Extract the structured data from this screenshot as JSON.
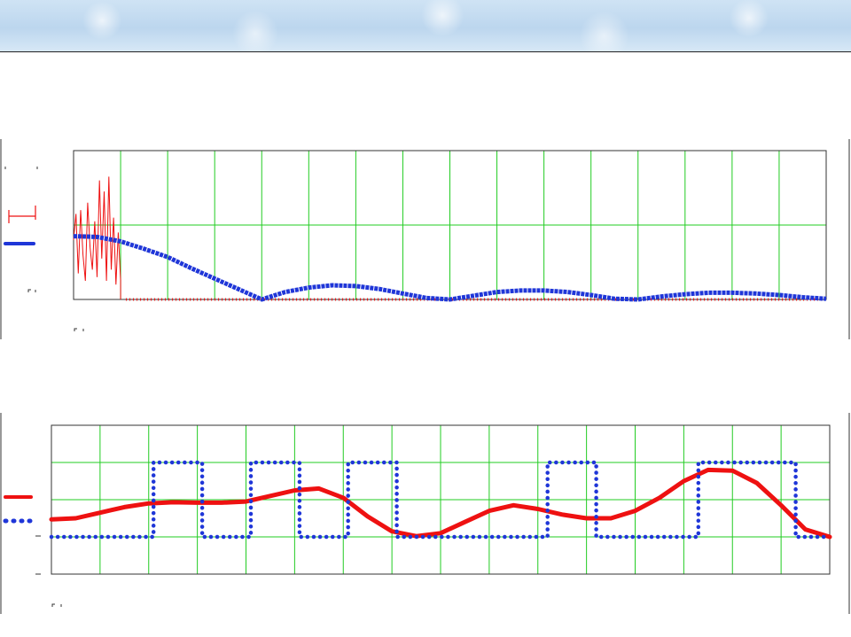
{
  "colors": {
    "background": "#ffffff",
    "header_band": "#c6ddf1",
    "grid": "#22cc22",
    "frame": "#333333",
    "blue_series": "#1f36d8",
    "red_series": "#ee1111"
  },
  "chart_data": [
    {
      "type": "line",
      "title": "",
      "xlabel": "",
      "ylabel": "",
      "xlim": [
        0,
        16
      ],
      "ylim": [
        0,
        2
      ],
      "grid": true,
      "legend": "left",
      "series": [
        {
          "role": "noisy-red",
          "color": "#ee1111",
          "style": "thin-line-then-ticks",
          "x": [
            0.0,
            0.05,
            0.1,
            0.15,
            0.2,
            0.25,
            0.3,
            0.35,
            0.4,
            0.45,
            0.5,
            0.55,
            0.6,
            0.65,
            0.7,
            0.75,
            0.8,
            0.85,
            0.9,
            0.95,
            1.0
          ],
          "y": [
            0.8,
            1.15,
            0.35,
            1.2,
            0.6,
            0.25,
            1.3,
            0.7,
            0.4,
            1.05,
            0.3,
            1.6,
            0.55,
            1.45,
            0.25,
            1.65,
            0.4,
            1.1,
            0.2,
            0.9,
            0.25
          ]
        },
        {
          "role": "blue-envelope",
          "color": "#1f36d8",
          "style": "thick-dotted",
          "x": [
            0,
            0.5,
            1,
            1.5,
            2,
            2.5,
            3,
            3.5,
            4,
            4.5,
            5,
            5.5,
            6,
            6.5,
            7,
            7.5,
            8,
            8.5,
            9,
            9.5,
            10,
            10.5,
            11,
            11.5,
            12,
            12.5,
            13,
            13.5,
            14,
            14.5,
            15,
            15.5,
            16
          ],
          "y": [
            0.85,
            0.84,
            0.78,
            0.68,
            0.57,
            0.42,
            0.28,
            0.14,
            0.0,
            0.1,
            0.16,
            0.19,
            0.18,
            0.14,
            0.08,
            0.02,
            0.0,
            0.05,
            0.1,
            0.12,
            0.12,
            0.1,
            0.06,
            0.01,
            0.0,
            0.04,
            0.07,
            0.09,
            0.09,
            0.08,
            0.06,
            0.03,
            0.01
          ]
        }
      ]
    },
    {
      "type": "line",
      "title": "",
      "xlabel": "",
      "ylabel": "",
      "xlim": [
        0,
        16
      ],
      "ylim": [
        0,
        4
      ],
      "grid": true,
      "legend": "left",
      "series": [
        {
          "role": "red-smooth",
          "color": "#ee1111",
          "style": "thick-line",
          "x": [
            0,
            0.5,
            1,
            1.5,
            2,
            2.5,
            3,
            3.5,
            4,
            4.5,
            5,
            5.5,
            6,
            6.5,
            7,
            7.5,
            8,
            8.5,
            9,
            9.5,
            10,
            10.5,
            11,
            11.5,
            12,
            12.5,
            13,
            13.5,
            14,
            14.5,
            15,
            15.5,
            16
          ],
          "y": [
            1.47,
            1.5,
            1.65,
            1.8,
            1.9,
            1.93,
            1.92,
            1.92,
            1.95,
            2.1,
            2.25,
            2.3,
            2.05,
            1.55,
            1.15,
            1.02,
            1.1,
            1.4,
            1.7,
            1.85,
            1.75,
            1.6,
            1.5,
            1.5,
            1.7,
            2.05,
            2.5,
            2.8,
            2.78,
            2.45,
            1.85,
            1.2,
            1.0
          ]
        },
        {
          "role": "blue-square-wave",
          "color": "#1f36d8",
          "style": "dotted",
          "x": [
            0,
            2.1,
            2.1,
            3.1,
            3.1,
            4.1,
            4.1,
            5.1,
            5.1,
            6.1,
            6.1,
            7.1,
            7.1,
            10.2,
            10.2,
            11.2,
            11.2,
            13.3,
            13.3,
            15.3,
            15.3,
            16
          ],
          "y": [
            1,
            1,
            3,
            3,
            1,
            1,
            3,
            3,
            1,
            1,
            3,
            3,
            1,
            1,
            3,
            3,
            1,
            1,
            3,
            3,
            1,
            1
          ]
        }
      ]
    }
  ]
}
